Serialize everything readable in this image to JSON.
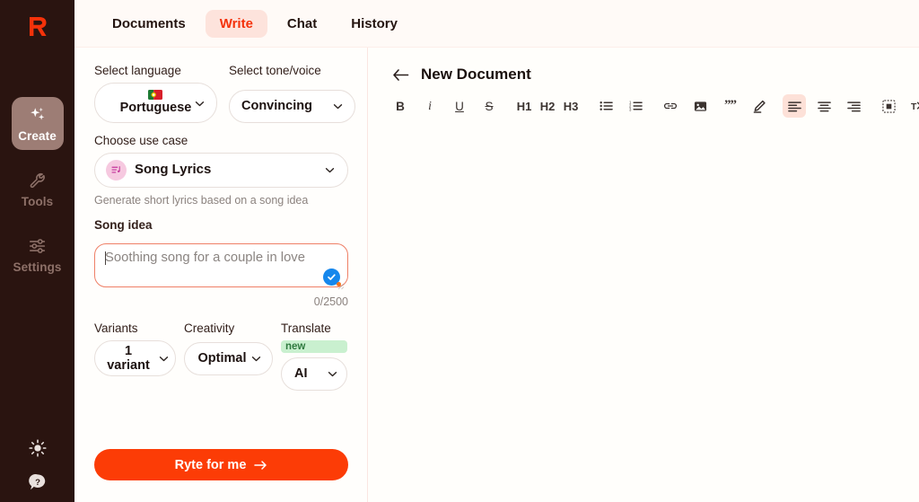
{
  "brand": {
    "logo_letter": "R",
    "logo_color": "#f4320a"
  },
  "sidebar": {
    "items": [
      {
        "label": "Create",
        "icon": "sparkles-icon",
        "active": true
      },
      {
        "label": "Tools",
        "icon": "wrench-icon",
        "active": false
      },
      {
        "label": "Settings",
        "icon": "sliders-icon",
        "active": false
      }
    ],
    "bottom": [
      {
        "name": "theme-toggle",
        "icon": "sun-icon"
      },
      {
        "name": "help",
        "icon": "question-bubble-icon"
      }
    ]
  },
  "tabs": [
    {
      "label": "Documents",
      "active": false
    },
    {
      "label": "Write",
      "active": true
    },
    {
      "label": "Chat",
      "active": false
    },
    {
      "label": "History",
      "active": false
    }
  ],
  "form": {
    "language": {
      "label": "Select language",
      "value": "Portuguese",
      "flag": "portugal-flag-icon"
    },
    "tone": {
      "label": "Select tone/voice",
      "value": "Convincing"
    },
    "use_case": {
      "label": "Choose use case",
      "value": "Song Lyrics",
      "icon": "song-lyrics-icon"
    },
    "use_case_helper": "Generate short lyrics based on a song idea",
    "song_idea": {
      "label": "Song idea",
      "value": "",
      "placeholder": "Soothing song for a couple in love",
      "counter": "0/2500"
    },
    "variants": {
      "label": "Variants",
      "value": "1 variant"
    },
    "creativity": {
      "label": "Creativity",
      "value": "Optimal"
    },
    "translate": {
      "label": "Translate",
      "badge": "new",
      "value": "AI"
    },
    "submit": {
      "label": "Ryte for me"
    }
  },
  "editor": {
    "back": "back-arrow",
    "title": "New Document",
    "toolbar": [
      {
        "name": "bold-button",
        "label": "B",
        "kind": "b",
        "active": false
      },
      {
        "name": "italic-button",
        "label": "i",
        "kind": "i",
        "active": false
      },
      {
        "name": "underline-button",
        "label": "U",
        "kind": "u",
        "active": false
      },
      {
        "name": "strikethrough-button",
        "label": "S",
        "kind": "s",
        "active": false
      },
      {
        "name": "heading-1-button",
        "label": "H1",
        "kind": "h",
        "active": false
      },
      {
        "name": "heading-2-button",
        "label": "H2",
        "kind": "h",
        "active": false
      },
      {
        "name": "heading-3-button",
        "label": "H3",
        "kind": "h",
        "active": false
      },
      {
        "name": "bulleted-list-button",
        "label": "",
        "kind": "icon-ul",
        "active": false
      },
      {
        "name": "numbered-list-button",
        "label": "",
        "kind": "icon-ol",
        "active": false
      },
      {
        "name": "link-button",
        "label": "",
        "kind": "icon-link",
        "active": false
      },
      {
        "name": "image-button",
        "label": "",
        "kind": "icon-image",
        "active": false
      },
      {
        "name": "quote-button",
        "label": "",
        "kind": "icon-quote",
        "active": false
      },
      {
        "name": "highlight-pen-button",
        "label": "",
        "kind": "icon-pen",
        "active": false
      },
      {
        "name": "align-left-button",
        "label": "",
        "kind": "icon-al",
        "active": true
      },
      {
        "name": "align-center-button",
        "label": "",
        "kind": "icon-ac",
        "active": false
      },
      {
        "name": "align-right-button",
        "label": "",
        "kind": "icon-ar",
        "active": false
      },
      {
        "name": "insert-block-button",
        "label": "",
        "kind": "icon-frame",
        "active": false
      },
      {
        "name": "clear-formatting-button",
        "label": "",
        "kind": "icon-clear",
        "active": false
      },
      {
        "name": "undo-button",
        "label": "",
        "kind": "icon-undo",
        "active": false
      }
    ]
  }
}
